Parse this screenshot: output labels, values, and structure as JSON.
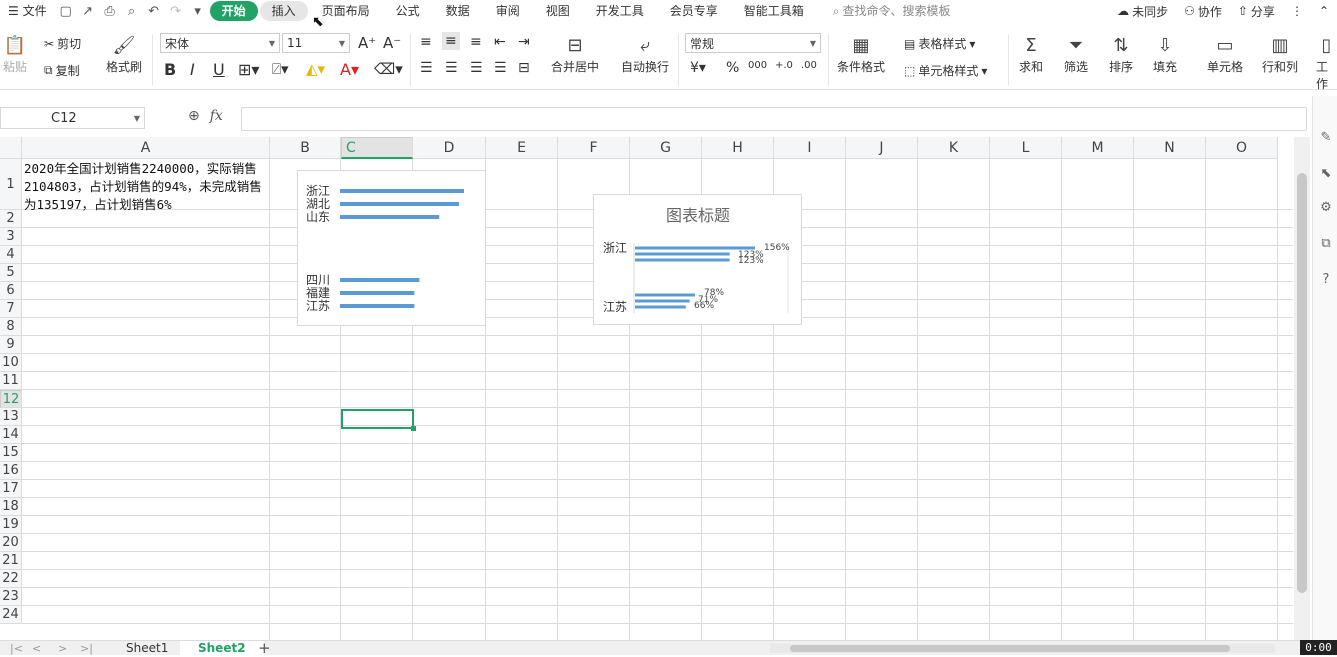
{
  "menubar": {
    "file": "文件",
    "tabs": [
      "开始",
      "插入",
      "页面布局",
      "公式",
      "数据",
      "审阅",
      "视图",
      "开发工具",
      "会员专享",
      "智能工具箱"
    ],
    "search_placeholder": "查找命令、搜索模板",
    "sync": "未同步",
    "collab": "协作",
    "share": "分享"
  },
  "ribbon": {
    "paste": "粘贴",
    "cut": "剪切",
    "copy": "复制",
    "format_painter": "格式刷",
    "font_name": "宋体",
    "font_size": "11",
    "merge_center": "合并居中",
    "wrap_text": "自动换行",
    "number_format": "常规",
    "conditional_format": "条件格式",
    "table_style": "表格样式",
    "cell_style": "单元格样式",
    "sum": "求和",
    "filter": "筛选",
    "sort": "排序",
    "fill": "填充",
    "cell": "单元格",
    "rows_cols": "行和列",
    "worksheet": "工作"
  },
  "formula_bar": {
    "name_box": "C12",
    "fx": "fx",
    "content": ""
  },
  "grid": {
    "columns": [
      "A",
      "B",
      "C",
      "D",
      "E",
      "F",
      "G",
      "H",
      "I",
      "J",
      "K",
      "L",
      "M",
      "N",
      "O"
    ],
    "rows": [
      "1",
      "2",
      "3",
      "4",
      "5",
      "6",
      "7",
      "8",
      "9",
      "10",
      "11",
      "12",
      "13",
      "14",
      "15",
      "16",
      "17",
      "18",
      "19",
      "20",
      "21",
      "22",
      "23",
      "24"
    ],
    "selected_column": "C",
    "selected_row": "12",
    "a1_text": "2020年全国计划销售2240000，实际销售2104803，占计划销售的94%，未完成销售为135197，占计划销售6%"
  },
  "chart_data": [
    {
      "type": "bar",
      "orientation": "horizontal",
      "title": "",
      "categories": [
        "浙江",
        "湖北",
        "山东",
        "",
        "",
        "",
        "",
        "四川",
        "福建",
        "江苏"
      ],
      "values": [
        5,
        4.8,
        4,
        0,
        0,
        0,
        0,
        3.2,
        3,
        3
      ],
      "color": "#5b9bd5"
    },
    {
      "type": "bar",
      "orientation": "horizontal",
      "title": "图表标题",
      "categories": [
        "浙江",
        "",
        "",
        "",
        "",
        "江苏"
      ],
      "values": [
        156,
        123,
        123,
        78,
        71,
        66
      ],
      "data_labels": [
        "156%",
        "123%",
        "123%",
        "78%",
        "71%",
        "66%"
      ],
      "color": "#5b9bd5"
    }
  ],
  "sheets": [
    "Sheet1",
    "Sheet2"
  ],
  "active_sheet": "Sheet2",
  "timer": "0:00",
  "colors": {
    "accent": "#21a366",
    "bar": "#5b9bd5"
  }
}
